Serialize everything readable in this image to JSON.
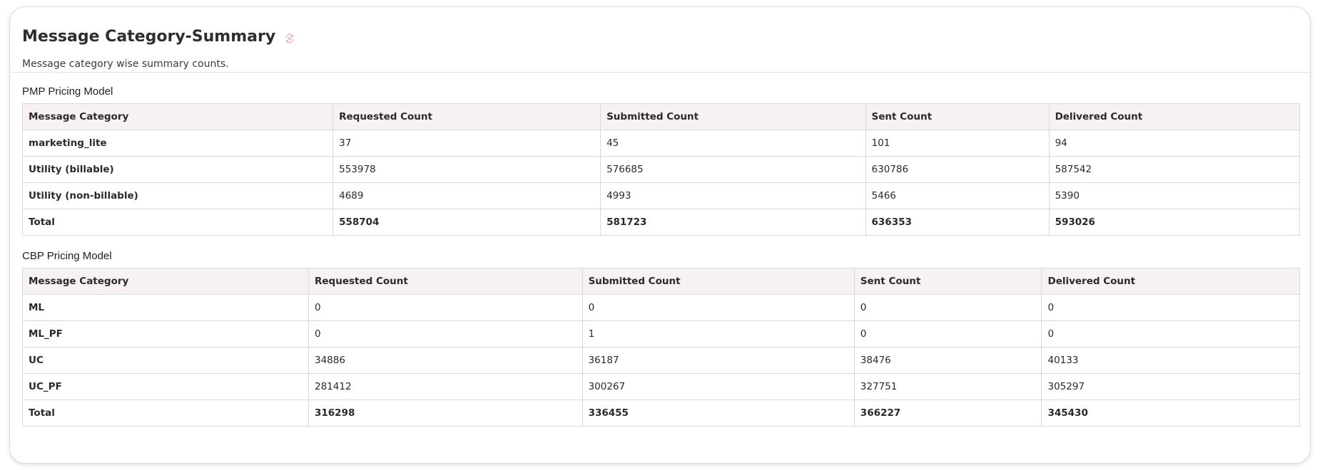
{
  "header": {
    "title": "Message Category-Summary",
    "subtitle": "Message category wise summary counts.",
    "refresh_icon": "refresh-icon",
    "accent_color": "#e8a6c6"
  },
  "pmp": {
    "title": "PMP Pricing Model",
    "columns": [
      "Message Category",
      "Requested Count",
      "Submitted Count",
      "Sent Count",
      "Delivered Count"
    ],
    "rows": [
      [
        "marketing_lite",
        "37",
        "45",
        "101",
        "94"
      ],
      [
        "Utility (billable)",
        "553978",
        "576685",
        "630786",
        "587542"
      ],
      [
        "Utility (non-billable)",
        "4689",
        "4993",
        "5466",
        "5390"
      ],
      [
        "Total",
        "558704",
        "581723",
        "636353",
        "593026"
      ]
    ]
  },
  "cbp": {
    "title": "CBP Pricing Model",
    "columns": [
      "Message Category",
      "Requested Count",
      "Submitted Count",
      "Sent Count",
      "Delivered Count"
    ],
    "rows": [
      [
        "ML",
        "0",
        "0",
        "0",
        "0"
      ],
      [
        "ML_PF",
        "0",
        "1",
        "0",
        "0"
      ],
      [
        "UC",
        "34886",
        "36187",
        "38476",
        "40133"
      ],
      [
        "UC_PF",
        "281412",
        "300267",
        "327751",
        "305297"
      ],
      [
        "Total",
        "316298",
        "336455",
        "366227",
        "345430"
      ]
    ]
  }
}
